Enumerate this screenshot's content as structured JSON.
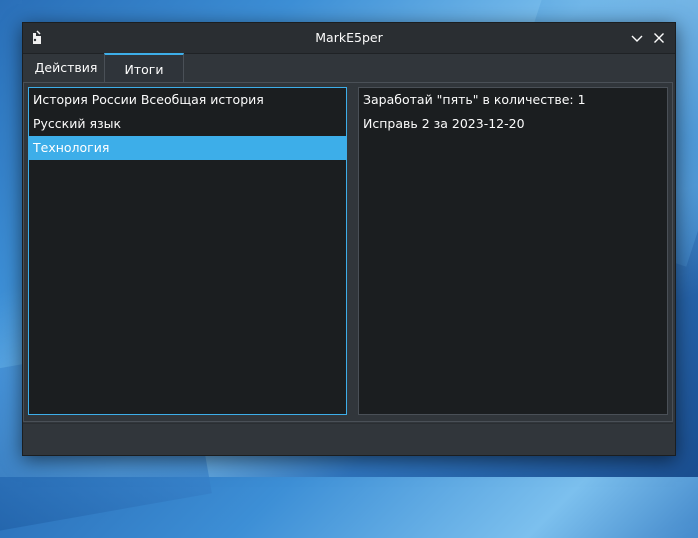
{
  "window": {
    "title": "MarkE5per"
  },
  "tabs": [
    {
      "label": "Действия",
      "active": false
    },
    {
      "label": "Итоги",
      "active": true
    }
  ],
  "subjects": [
    {
      "label": "История России Всеобщая история",
      "selected": false
    },
    {
      "label": "Русский язык",
      "selected": false
    },
    {
      "label": "Технология",
      "selected": true
    }
  ],
  "details": [
    "Заработай \"пять\" в количестве: 1",
    "Исправь 2 за 2023-12-20"
  ],
  "colors": {
    "accent": "#3daee9",
    "window_bg": "#31363b",
    "view_bg": "#1b1e20"
  }
}
